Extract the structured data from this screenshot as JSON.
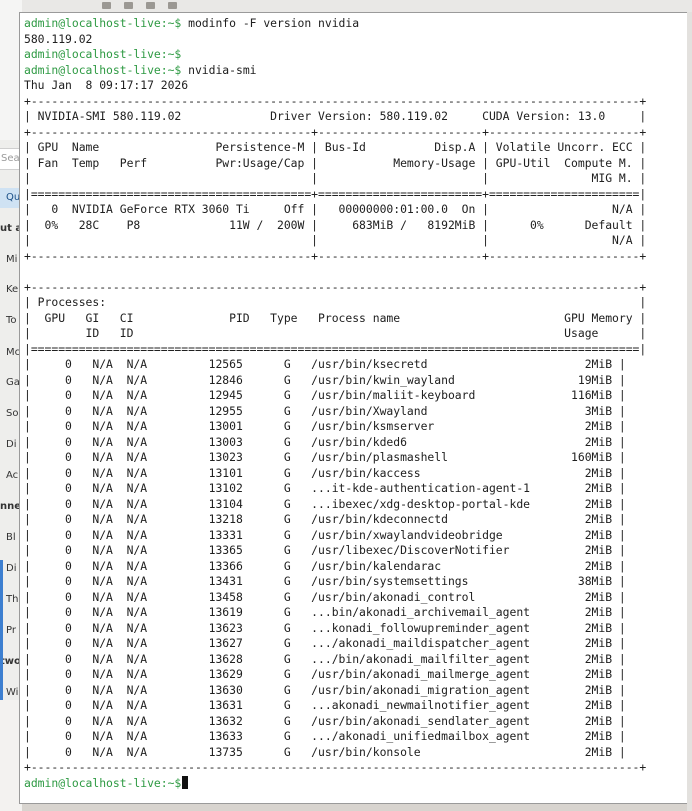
{
  "background_window": {
    "search_placeholder": "Sea",
    "items": [
      {
        "label": "Qu",
        "selected": true,
        "bold": false
      },
      {
        "label": "ut a",
        "selected": false,
        "bold": true
      },
      {
        "label": "Mi",
        "selected": false,
        "bold": false
      },
      {
        "label": "Ke",
        "selected": false,
        "bold": false
      },
      {
        "label": "To",
        "selected": false,
        "bold": false
      },
      {
        "label": "Mc",
        "selected": false,
        "bold": false
      },
      {
        "label": "Ga",
        "selected": false,
        "bold": false
      },
      {
        "label": "So",
        "selected": false,
        "bold": false
      },
      {
        "label": "Di",
        "selected": false,
        "bold": false
      },
      {
        "label": "Ac",
        "selected": false,
        "bold": false
      },
      {
        "label": "nne",
        "selected": false,
        "bold": true
      },
      {
        "label": "Bl",
        "selected": false,
        "bold": false
      },
      {
        "label": "Di",
        "selected": false,
        "bold": false
      },
      {
        "label": "Th",
        "selected": false,
        "bold": false
      },
      {
        "label": "Pr",
        "selected": false,
        "bold": false
      },
      {
        "label": "two",
        "selected": false,
        "bold": true
      },
      {
        "label": "Wi",
        "selected": false,
        "bold": false
      }
    ]
  },
  "terminal": {
    "prompt": "admin@localhost-live:~$",
    "cmd1": " modinfo -F version nvidia",
    "out1": "580.119.02",
    "cmd2": "",
    "cmd3": " nvidia-smi",
    "date": "Thu Jan  8 09:17:17 2026",
    "smi_header": [
      "+-----------------------------------------------------------------------------------------+",
      "| NVIDIA-SMI 580.119.02             Driver Version: 580.119.02     CUDA Version: 13.0     |",
      "+-----------------------------------------+------------------------+----------------------+",
      "| GPU  Name                 Persistence-M | Bus-Id          Disp.A | Volatile Uncorr. ECC |",
      "| Fan  Temp   Perf          Pwr:Usage/Cap |           Memory-Usage | GPU-Util  Compute M. |",
      "|                                         |                        |               MIG M. |",
      "|=========================================+========================+======================|",
      "|   0  NVIDIA GeForce RTX 3060 Ti     Off |   00000000:01:00.0  On |                  N/A |",
      "|  0%   28C    P8             11W /  200W |     683MiB /   8192MiB |      0%      Default |",
      "|                                         |                        |                  N/A |",
      "+-----------------------------------------+------------------------+----------------------+",
      "",
      "+-----------------------------------------------------------------------------------------+",
      "| Processes:                                                                              |",
      "|  GPU   GI   CI              PID   Type   Process name                        GPU Memory |",
      "|        ID   ID                                                               Usage      |",
      "|=========================================================================================|"
    ],
    "processes": [
      {
        "gpu": "0",
        "gi": "N/A",
        "ci": "N/A",
        "pid": "12565",
        "type": "G",
        "name": "/usr/bin/ksecretd",
        "mem": "2MiB"
      },
      {
        "gpu": "0",
        "gi": "N/A",
        "ci": "N/A",
        "pid": "12846",
        "type": "G",
        "name": "/usr/bin/kwin_wayland",
        "mem": "19MiB"
      },
      {
        "gpu": "0",
        "gi": "N/A",
        "ci": "N/A",
        "pid": "12945",
        "type": "G",
        "name": "/usr/bin/maliit-keyboard",
        "mem": "116MiB"
      },
      {
        "gpu": "0",
        "gi": "N/A",
        "ci": "N/A",
        "pid": "12955",
        "type": "G",
        "name": "/usr/bin/Xwayland",
        "mem": "3MiB"
      },
      {
        "gpu": "0",
        "gi": "N/A",
        "ci": "N/A",
        "pid": "13001",
        "type": "G",
        "name": "/usr/bin/ksmserver",
        "mem": "2MiB"
      },
      {
        "gpu": "0",
        "gi": "N/A",
        "ci": "N/A",
        "pid": "13003",
        "type": "G",
        "name": "/usr/bin/kded6",
        "mem": "2MiB"
      },
      {
        "gpu": "0",
        "gi": "N/A",
        "ci": "N/A",
        "pid": "13023",
        "type": "G",
        "name": "/usr/bin/plasmashell",
        "mem": "160MiB"
      },
      {
        "gpu": "0",
        "gi": "N/A",
        "ci": "N/A",
        "pid": "13101",
        "type": "G",
        "name": "/usr/bin/kaccess",
        "mem": "2MiB"
      },
      {
        "gpu": "0",
        "gi": "N/A",
        "ci": "N/A",
        "pid": "13102",
        "type": "G",
        "name": "...it-kde-authentication-agent-1",
        "mem": "2MiB"
      },
      {
        "gpu": "0",
        "gi": "N/A",
        "ci": "N/A",
        "pid": "13104",
        "type": "G",
        "name": "...ibexec/xdg-desktop-portal-kde",
        "mem": "2MiB"
      },
      {
        "gpu": "0",
        "gi": "N/A",
        "ci": "N/A",
        "pid": "13218",
        "type": "G",
        "name": "/usr/bin/kdeconnectd",
        "mem": "2MiB"
      },
      {
        "gpu": "0",
        "gi": "N/A",
        "ci": "N/A",
        "pid": "13331",
        "type": "G",
        "name": "/usr/bin/xwaylandvideobridge",
        "mem": "2MiB"
      },
      {
        "gpu": "0",
        "gi": "N/A",
        "ci": "N/A",
        "pid": "13365",
        "type": "G",
        "name": "/usr/libexec/DiscoverNotifier",
        "mem": "2MiB"
      },
      {
        "gpu": "0",
        "gi": "N/A",
        "ci": "N/A",
        "pid": "13366",
        "type": "G",
        "name": "/usr/bin/kalendarac",
        "mem": "2MiB"
      },
      {
        "gpu": "0",
        "gi": "N/A",
        "ci": "N/A",
        "pid": "13431",
        "type": "G",
        "name": "/usr/bin/systemsettings",
        "mem": "38MiB"
      },
      {
        "gpu": "0",
        "gi": "N/A",
        "ci": "N/A",
        "pid": "13458",
        "type": "G",
        "name": "/usr/bin/akonadi_control",
        "mem": "2MiB"
      },
      {
        "gpu": "0",
        "gi": "N/A",
        "ci": "N/A",
        "pid": "13619",
        "type": "G",
        "name": "...bin/akonadi_archivemail_agent",
        "mem": "2MiB"
      },
      {
        "gpu": "0",
        "gi": "N/A",
        "ci": "N/A",
        "pid": "13623",
        "type": "G",
        "name": "...konadi_followupreminder_agent",
        "mem": "2MiB"
      },
      {
        "gpu": "0",
        "gi": "N/A",
        "ci": "N/A",
        "pid": "13627",
        "type": "G",
        "name": ".../akonadi_maildispatcher_agent",
        "mem": "2MiB"
      },
      {
        "gpu": "0",
        "gi": "N/A",
        "ci": "N/A",
        "pid": "13628",
        "type": "G",
        "name": ".../bin/akonadi_mailfilter_agent",
        "mem": "2MiB"
      },
      {
        "gpu": "0",
        "gi": "N/A",
        "ci": "N/A",
        "pid": "13629",
        "type": "G",
        "name": "/usr/bin/akonadi_mailmerge_agent",
        "mem": "2MiB"
      },
      {
        "gpu": "0",
        "gi": "N/A",
        "ci": "N/A",
        "pid": "13630",
        "type": "G",
        "name": "/usr/bin/akonadi_migration_agent",
        "mem": "2MiB"
      },
      {
        "gpu": "0",
        "gi": "N/A",
        "ci": "N/A",
        "pid": "13631",
        "type": "G",
        "name": "...akonadi_newmailnotifier_agent",
        "mem": "2MiB"
      },
      {
        "gpu": "0",
        "gi": "N/A",
        "ci": "N/A",
        "pid": "13632",
        "type": "G",
        "name": "/usr/bin/akonadi_sendlater_agent",
        "mem": "2MiB"
      },
      {
        "gpu": "0",
        "gi": "N/A",
        "ci": "N/A",
        "pid": "13633",
        "type": "G",
        "name": ".../akonadi_unifiedmailbox_agent",
        "mem": "2MiB"
      },
      {
        "gpu": "0",
        "gi": "N/A",
        "ci": "N/A",
        "pid": "13735",
        "type": "G",
        "name": "/usr/bin/konsole",
        "mem": "2MiB"
      }
    ],
    "smi_footer": "+-----------------------------------------------------------------------------------------+",
    "final_command": ""
  },
  "colors": {
    "prompt": "#2e9a43",
    "terminal_bg": "#ffffff",
    "text": "#202020"
  }
}
